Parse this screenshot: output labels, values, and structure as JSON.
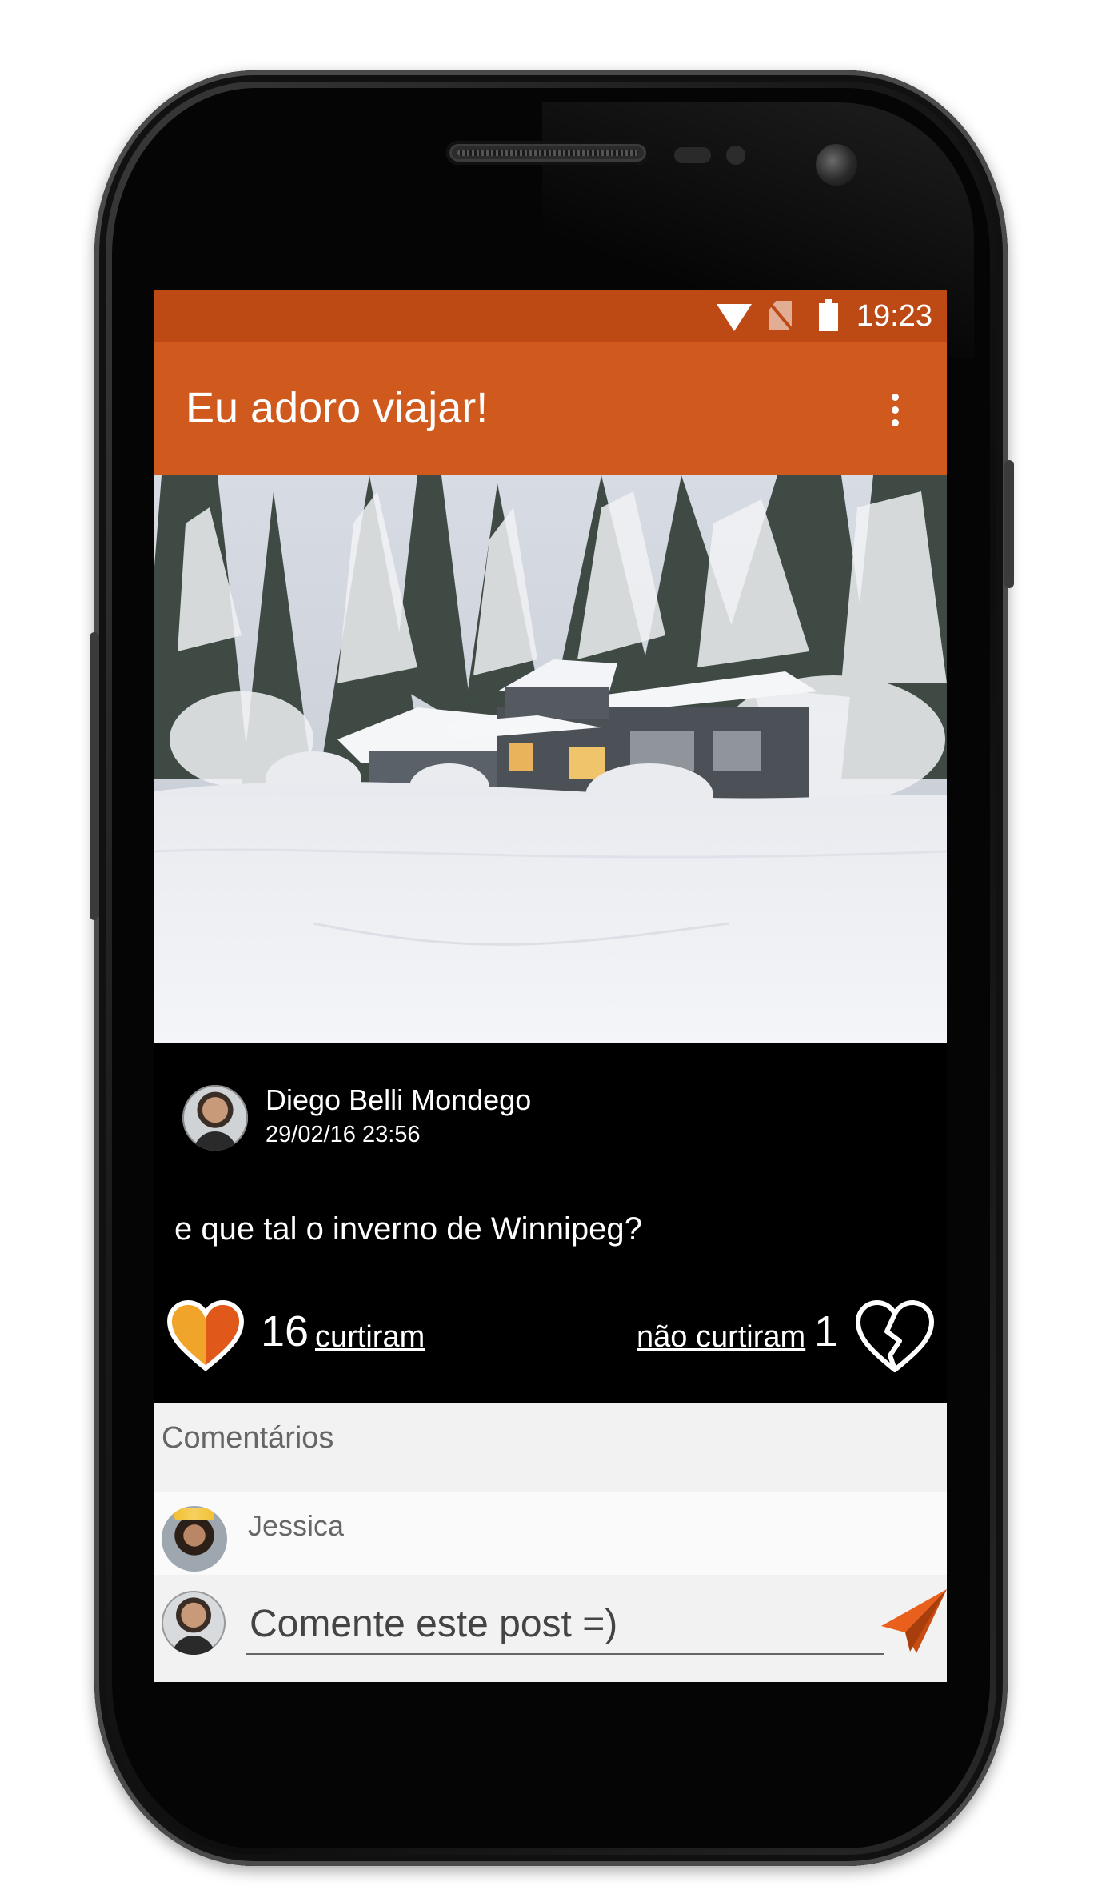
{
  "status_bar": {
    "time": "19:23"
  },
  "app_bar": {
    "title": "Eu adoro viajar!"
  },
  "post": {
    "author": "Diego Belli Mondego",
    "date": "29/02/16 23:56",
    "text": "e que tal o inverno de Winnipeg?",
    "likes_count": "16",
    "likes_label": "curtiram",
    "dislikes_label": "não curtiram",
    "dislikes_count": "1"
  },
  "comments": {
    "header": "Comentários",
    "items": [
      {
        "author": "Jessica"
      }
    ],
    "input_placeholder": "Comente este post =)"
  },
  "colors": {
    "status_bar": "#bd4915",
    "app_bar": "#d05a1e",
    "accent": "#e8601c",
    "like_heart_yellow": "#f0a52a",
    "like_heart_orange": "#e0581a"
  }
}
